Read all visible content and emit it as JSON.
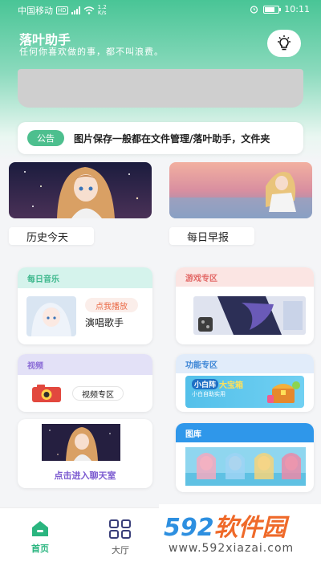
{
  "status_bar": {
    "carrier": "中国移动",
    "network": "HD",
    "speed_value": "1.2",
    "speed_unit": "K/s",
    "time": "10:11"
  },
  "header": {
    "title": "落叶助手",
    "subtitle": "任何你喜欢做的事，都不叫浪费。",
    "accent": "#4dbf8e"
  },
  "notice": {
    "tag": "公告",
    "text": "图片保存一般都在文件管理/落叶助手，文件夹"
  },
  "feature_pictures": [
    {
      "label": "历史今天"
    },
    {
      "label": "每日早报"
    }
  ],
  "cards": {
    "music": {
      "title": "每日音乐",
      "button": "点我播放",
      "text": "演唱歌手",
      "head_color": "#d5f3ec"
    },
    "games": {
      "title": "游戏专区",
      "head_color": "#fbe5e3"
    },
    "video": {
      "title": "视频",
      "button": "视频专区",
      "head_color": "#e3e1f7"
    },
    "functions": {
      "title": "功能专区",
      "badge_left": "小白阵",
      "badge_right": "大宝箱",
      "badge_caption": "小白自助实用",
      "head_color": "#e1ecfa"
    },
    "chat": {
      "link": "点击进入聊天室"
    },
    "gallery": {
      "title": "图库",
      "head_color": "#2f97ea"
    }
  },
  "tabbar": {
    "items": [
      {
        "label": "首页",
        "active": true
      },
      {
        "label": "大厅",
        "active": false
      }
    ]
  },
  "watermark": {
    "brand": "592软件园",
    "url": "www.592xiazai.com"
  }
}
